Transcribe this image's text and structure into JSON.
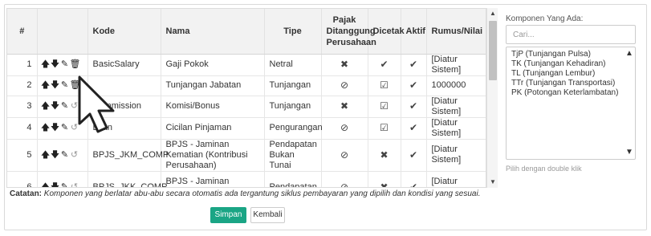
{
  "table": {
    "headers": {
      "no": "#",
      "actions": "",
      "kode": "Kode",
      "nama": "Nama",
      "tipe": "Tipe",
      "pajak": "Pajak Ditanggung Perusahaan",
      "dicetak": "Dicetak",
      "aktif": "Aktif",
      "rumus": "Rumus/Nilai"
    },
    "rows": [
      {
        "no": "1",
        "kode": "BasicSalary",
        "nama": "Gaji Pokok",
        "tipe": "Netral",
        "pajak": "✖",
        "dicetak": "✔",
        "aktif": "✔",
        "rumus": "[Diatur Sistem]"
      },
      {
        "no": "2",
        "kode": "",
        "nama": "Tunjangan Jabatan",
        "tipe": "Tunjangan",
        "pajak": "⊘",
        "dicetak": "☑",
        "aktif": "✔",
        "rumus": "1000000"
      },
      {
        "no": "3",
        "kode": "Commission",
        "nama": "Komisi/Bonus",
        "tipe": "Tunjangan",
        "pajak": "✖",
        "dicetak": "☑",
        "aktif": "✔",
        "rumus": "[Diatur Sistem]"
      },
      {
        "no": "4",
        "kode": "Loan",
        "nama": "Cicilan Pinjaman",
        "tipe": "Pengurangan",
        "pajak": "⊘",
        "dicetak": "☑",
        "aktif": "✔",
        "rumus": "[Diatur Sistem]"
      },
      {
        "no": "5",
        "kode": "BPJS_JKM_COMP",
        "nama": "BPJS - Jaminan Kematian (Kontribusi Perusahaan)",
        "tipe": "Pendapatan Bukan Tunai",
        "pajak": "⊘",
        "dicetak": "✖",
        "aktif": "✔",
        "rumus": "[Diatur Sistem]"
      },
      {
        "no": "6",
        "kode": "BPJS_JKK_COMP",
        "nama": "BPJS - Jaminan Kecelakaan",
        "tipe": "Pendapatan",
        "pajak": "⊘",
        "dicetak": "✖",
        "aktif": "✔",
        "rumus": "[Diatur Sistem]"
      }
    ]
  },
  "note": {
    "label": "Catatan:",
    "text": " Komponen yang berlatar abu-abu secara otomatis ada tergantung siklus pembayaran yang dipilih dan kondisi yang sesuai."
  },
  "buttons": {
    "save": "Simpan",
    "back": "Kembali"
  },
  "components_panel": {
    "label": "Komponen Yang Ada:",
    "search_placeholder": "Cari...",
    "items": [
      "TjP (Tunjangan Pulsa)",
      "TK (Tunjangan Kehadiran)",
      "TL (Tunjangan Lembur)",
      "TTr (Tunjangan Transportasi)",
      "PK (Potongan Keterlambatan)"
    ],
    "hint": "Pilih dengan double klik"
  }
}
